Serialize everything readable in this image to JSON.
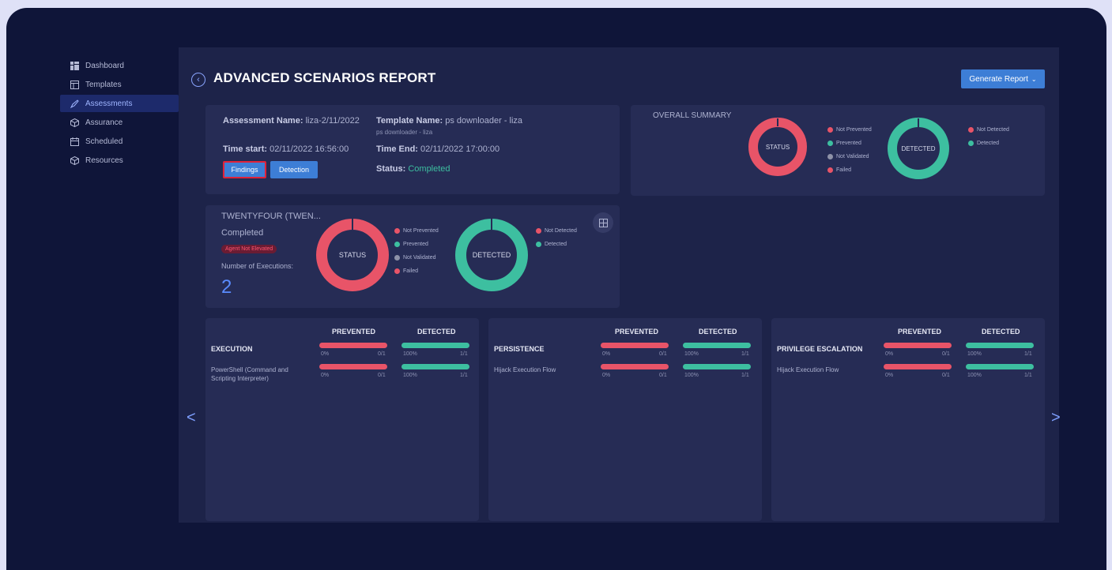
{
  "sidebar": {
    "items": [
      {
        "label": "Dashboard",
        "icon": "dashboard-icon"
      },
      {
        "label": "Templates",
        "icon": "template-icon"
      },
      {
        "label": "Assessments",
        "icon": "rocket-icon"
      },
      {
        "label": "Assurance",
        "icon": "cube-icon"
      },
      {
        "label": "Scheduled",
        "icon": "calendar-icon"
      },
      {
        "label": "Resources",
        "icon": "cube-icon"
      }
    ]
  },
  "header": {
    "title": "ADVANCED SCENARIOS REPORT",
    "generate_label": "Generate Report"
  },
  "assessment": {
    "name_label": "Assessment Name:",
    "name_value": "liza-2/11/2022",
    "template_label": "Template Name:",
    "template_value": "ps downloader - liza",
    "template_sub": "ps downloader - liza",
    "start_label": "Time start:",
    "start_value": "02/11/2022 16:56:00",
    "end_label": "Time End:",
    "end_value": "02/11/2022 17:00:00",
    "status_label": "Status:",
    "status_value": "Completed",
    "findings_label": "Findings",
    "detection_label": "Detection"
  },
  "summary": {
    "title": "OVERALL SUMMARY",
    "status_label": "STATUS",
    "detected_label": "DETECTED",
    "status_legend": [
      "Not Prevented",
      "Prevented",
      "Not Validated",
      "Failed"
    ],
    "detected_legend": [
      "Not Detected",
      "Detected"
    ]
  },
  "agent": {
    "name": "TWENTYFOUR (TWEN...",
    "state": "Completed",
    "badge": "Agent Not Elevated",
    "exec_label": "Number of Executions:",
    "exec_count": "2",
    "status_label": "STATUS",
    "detected_label": "DETECTED",
    "status_legend": [
      "Not Prevented",
      "Prevented",
      "Not Validated",
      "Failed"
    ],
    "detected_legend": [
      "Not Detected",
      "Detected"
    ]
  },
  "tactics": {
    "prevented_label": "PREVENTED",
    "detected_label": "DETECTED",
    "panels": [
      {
        "title": "EXECUTION",
        "title_prev": "0%",
        "title_prev_ratio": "0/1",
        "title_det": "100%",
        "title_det_ratio": "1/1",
        "row_label": "PowerShell (Command and Scripting Interpreter)",
        "row_prev": "0%",
        "row_prev_ratio": "0/1",
        "row_det": "100%",
        "row_det_ratio": "1/1"
      },
      {
        "title": "PERSISTENCE",
        "title_prev": "0%",
        "title_prev_ratio": "0/1",
        "title_det": "100%",
        "title_det_ratio": "1/1",
        "row_label": "Hijack Execution Flow",
        "row_prev": "0%",
        "row_prev_ratio": "0/1",
        "row_det": "100%",
        "row_det_ratio": "1/1"
      },
      {
        "title": "PRIVILEGE ESCALATION",
        "title_prev": "0%",
        "title_prev_ratio": "0/1",
        "title_det": "100%",
        "title_det_ratio": "1/1",
        "row_label": "Hijack Execution Flow",
        "row_prev": "0%",
        "row_prev_ratio": "0/1",
        "row_det": "100%",
        "row_det_ratio": "1/1"
      }
    ]
  },
  "colors": {
    "red": "#e85468",
    "green": "#3dbfa0",
    "grey": "#8e92a8",
    "accent": "#3d7ed6"
  }
}
